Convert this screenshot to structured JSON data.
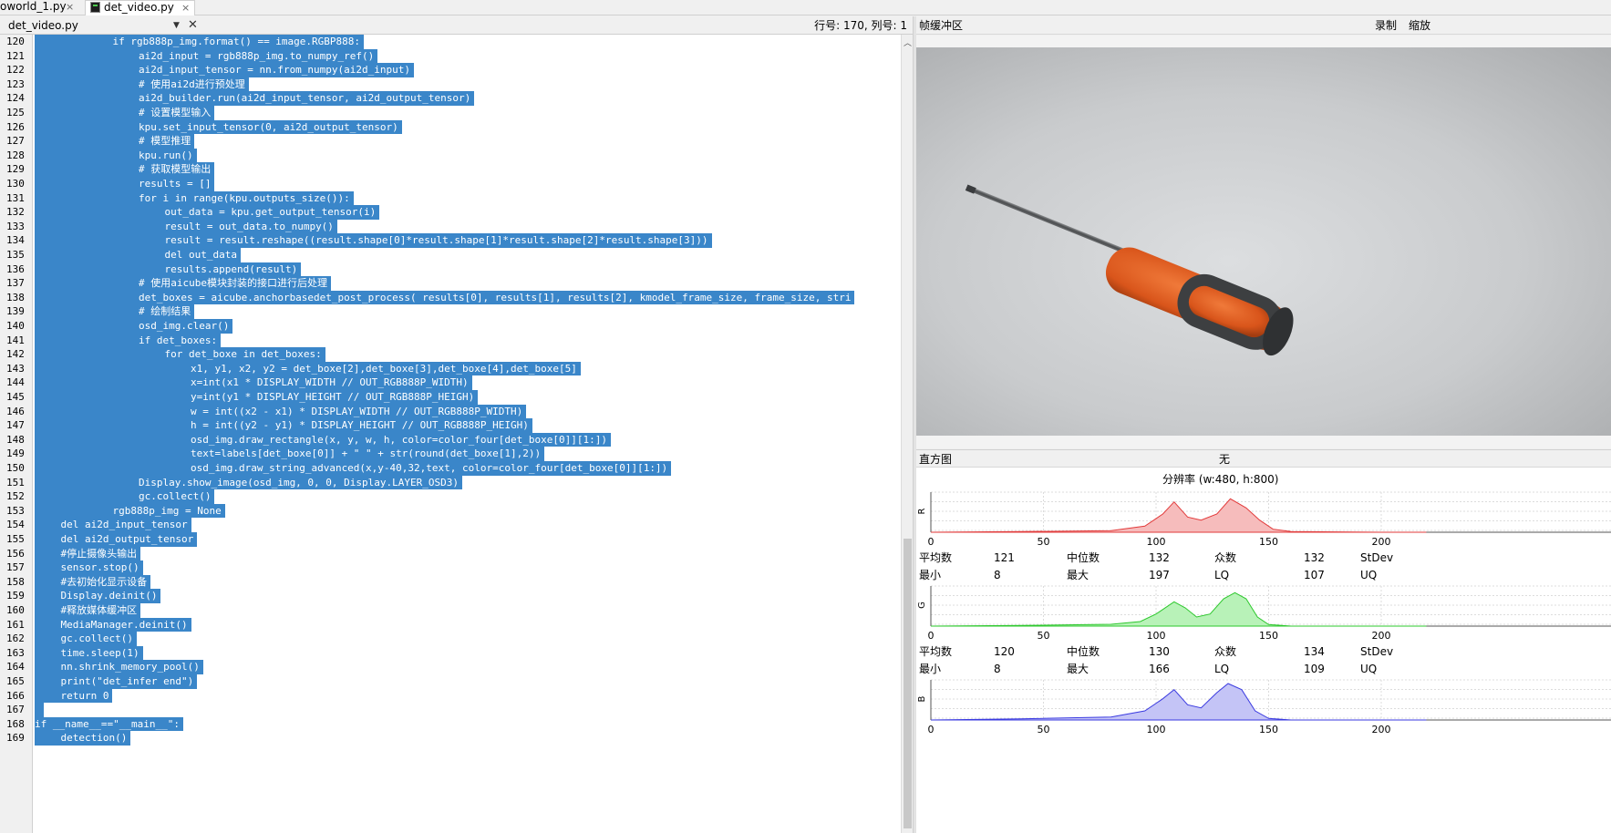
{
  "tabs": [
    {
      "label": "oworld_1.py",
      "close": "×"
    },
    {
      "label": "det_video.py",
      "close": "×"
    }
  ],
  "editor_header": {
    "filename": "det_video.py",
    "dropdown": "▼",
    "close": "✕",
    "position": "行号: 170, 列号: 1"
  },
  "code_lines": [
    {
      "n": "120",
      "indent": 3,
      "text": "if rgb888p_img.format() == image.RGBP888:"
    },
    {
      "n": "121",
      "indent": 4,
      "text": "ai2d_input = rgb888p_img.to_numpy_ref()"
    },
    {
      "n": "122",
      "indent": 4,
      "text": "ai2d_input_tensor = nn.from_numpy(ai2d_input)"
    },
    {
      "n": "123",
      "indent": 4,
      "text": "# 使用ai2d进行预处理"
    },
    {
      "n": "124",
      "indent": 4,
      "text": "ai2d_builder.run(ai2d_input_tensor, ai2d_output_tensor)"
    },
    {
      "n": "125",
      "indent": 4,
      "text": "# 设置模型输入"
    },
    {
      "n": "126",
      "indent": 4,
      "text": "kpu.set_input_tensor(0, ai2d_output_tensor)"
    },
    {
      "n": "127",
      "indent": 4,
      "text": "# 模型推理"
    },
    {
      "n": "128",
      "indent": 4,
      "text": "kpu.run()"
    },
    {
      "n": "129",
      "indent": 4,
      "text": "# 获取模型输出"
    },
    {
      "n": "130",
      "indent": 4,
      "text": "results = []"
    },
    {
      "n": "131",
      "indent": 4,
      "text": "for i in range(kpu.outputs_size()):"
    },
    {
      "n": "132",
      "indent": 5,
      "text": "out_data = kpu.get_output_tensor(i)"
    },
    {
      "n": "133",
      "indent": 5,
      "text": "result = out_data.to_numpy()"
    },
    {
      "n": "134",
      "indent": 5,
      "text": "result = result.reshape((result.shape[0]*result.shape[1]*result.shape[2]*result.shape[3]))"
    },
    {
      "n": "135",
      "indent": 5,
      "text": "del out_data"
    },
    {
      "n": "136",
      "indent": 5,
      "text": "results.append(result)"
    },
    {
      "n": "137",
      "indent": 4,
      "text": "# 使用aicube模块封装的接口进行后处理"
    },
    {
      "n": "138",
      "indent": 4,
      "text": "det_boxes = aicube.anchorbasedet_post_process( results[0], results[1], results[2], kmodel_frame_size, frame_size, stri"
    },
    {
      "n": "139",
      "indent": 4,
      "text": "# 绘制结果"
    },
    {
      "n": "140",
      "indent": 4,
      "text": "osd_img.clear()"
    },
    {
      "n": "141",
      "indent": 4,
      "text": "if det_boxes:"
    },
    {
      "n": "142",
      "indent": 5,
      "text": "for det_boxe in det_boxes:"
    },
    {
      "n": "143",
      "indent": 6,
      "text": "x1, y1, x2, y2 = det_boxe[2],det_boxe[3],det_boxe[4],det_boxe[5]"
    },
    {
      "n": "144",
      "indent": 6,
      "text": "x=int(x1 * DISPLAY_WIDTH // OUT_RGB888P_WIDTH)"
    },
    {
      "n": "145",
      "indent": 6,
      "text": "y=int(y1 * DISPLAY_HEIGHT // OUT_RGB888P_HEIGH)"
    },
    {
      "n": "146",
      "indent": 6,
      "text": "w = int((x2 - x1) * DISPLAY_WIDTH // OUT_RGB888P_WIDTH)"
    },
    {
      "n": "147",
      "indent": 6,
      "text": "h = int((y2 - y1) * DISPLAY_HEIGHT // OUT_RGB888P_HEIGH)"
    },
    {
      "n": "148",
      "indent": 6,
      "text": "osd_img.draw_rectangle(x, y, w, h, color=color_four[det_boxe[0]][1:])"
    },
    {
      "n": "149",
      "indent": 6,
      "text": "text=labels[det_boxe[0]] + \" \" + str(round(det_boxe[1],2))"
    },
    {
      "n": "150",
      "indent": 6,
      "text": "osd_img.draw_string_advanced(x,y-40,32,text, color=color_four[det_boxe[0]][1:])"
    },
    {
      "n": "151",
      "indent": 4,
      "text": "Display.show_image(osd_img, 0, 0, Display.LAYER_OSD3)"
    },
    {
      "n": "152",
      "indent": 4,
      "text": "gc.collect()"
    },
    {
      "n": "153",
      "indent": 3,
      "text": "rgb888p_img = None"
    },
    {
      "n": "154",
      "indent": 1,
      "text": "del ai2d_input_tensor"
    },
    {
      "n": "155",
      "indent": 1,
      "text": "del ai2d_output_tensor"
    },
    {
      "n": "156",
      "indent": 1,
      "text": "#停止摄像头输出"
    },
    {
      "n": "157",
      "indent": 1,
      "text": "sensor.stop()"
    },
    {
      "n": "158",
      "indent": 1,
      "text": "#去初始化显示设备"
    },
    {
      "n": "159",
      "indent": 1,
      "text": "Display.deinit()"
    },
    {
      "n": "160",
      "indent": 1,
      "text": "#释放媒体缓冲区"
    },
    {
      "n": "161",
      "indent": 1,
      "text": "MediaManager.deinit()"
    },
    {
      "n": "162",
      "indent": 1,
      "text": "gc.collect()"
    },
    {
      "n": "163",
      "indent": 1,
      "text": "time.sleep(1)"
    },
    {
      "n": "164",
      "indent": 1,
      "text": "nn.shrink_memory_pool()"
    },
    {
      "n": "165",
      "indent": 1,
      "text": "print(\"det_infer end\")"
    },
    {
      "n": "166",
      "indent": 1,
      "text": "return 0"
    },
    {
      "n": "167",
      "indent": 0,
      "text": ""
    },
    {
      "n": "168",
      "indent": 0,
      "text": "if __name__==\"__main__\":"
    },
    {
      "n": "169",
      "indent": 1,
      "text": "detection()"
    }
  ],
  "framebuffer": {
    "title": "帧缓冲区",
    "record": "录制",
    "zoom": "缩放"
  },
  "histogram": {
    "title": "直方图",
    "mode": "无",
    "resolution": "分辨率 (w:480, h:800)",
    "ticks": [
      "0",
      "50",
      "100",
      "150",
      "200"
    ],
    "channels": [
      {
        "id": "R",
        "color": "#e23a3a",
        "fill": "#f6bcbc",
        "stats1": [
          "平均数",
          "121",
          "中位数",
          "132",
          "众数",
          "132",
          "StDev"
        ],
        "stats2": [
          "最小",
          "8",
          "最大",
          "197",
          "LQ",
          "107",
          "UQ"
        ]
      },
      {
        "id": "G",
        "color": "#2dc82d",
        "fill": "#b8f2b8",
        "stats1": [
          "平均数",
          "120",
          "中位数",
          "130",
          "众数",
          "134",
          "StDev"
        ],
        "stats2": [
          "最小",
          "8",
          "最大",
          "166",
          "LQ",
          "109",
          "UQ"
        ]
      },
      {
        "id": "B",
        "color": "#3a3ae0",
        "fill": "#c4c4f6"
      }
    ]
  },
  "chart_data": [
    {
      "type": "area",
      "series": [
        {
          "name": "R",
          "values": [
            [
              0,
              0
            ],
            [
              40,
              0.2
            ],
            [
              80,
              0.5
            ],
            [
              95,
              2
            ],
            [
              103,
              6
            ],
            [
              108,
              10
            ],
            [
              114,
              5
            ],
            [
              120,
              4
            ],
            [
              127,
              6
            ],
            [
              133,
              11
            ],
            [
              140,
              8
            ],
            [
              146,
              4
            ],
            [
              152,
              1
            ],
            [
              160,
              0.2
            ],
            [
              200,
              0
            ]
          ]
        }
      ],
      "xlim": [
        0,
        220
      ]
    },
    {
      "type": "area",
      "series": [
        {
          "name": "G",
          "values": [
            [
              0,
              0
            ],
            [
              40,
              0.2
            ],
            [
              80,
              0.6
            ],
            [
              93,
              1.5
            ],
            [
              100,
              4
            ],
            [
              108,
              8
            ],
            [
              113,
              6
            ],
            [
              118,
              3
            ],
            [
              124,
              4
            ],
            [
              130,
              9
            ],
            [
              135,
              11
            ],
            [
              140,
              9
            ],
            [
              145,
              3
            ],
            [
              150,
              0.5
            ],
            [
              160,
              0
            ],
            [
              200,
              0
            ]
          ]
        }
      ],
      "xlim": [
        0,
        220
      ]
    },
    {
      "type": "area",
      "series": [
        {
          "name": "B",
          "values": [
            [
              0,
              0
            ],
            [
              40,
              0.4
            ],
            [
              80,
              1
            ],
            [
              95,
              3
            ],
            [
              103,
              7
            ],
            [
              108,
              10
            ],
            [
              114,
              5
            ],
            [
              120,
              4
            ],
            [
              127,
              9
            ],
            [
              132,
              12
            ],
            [
              138,
              10
            ],
            [
              144,
              3
            ],
            [
              150,
              0.5
            ],
            [
              160,
              0
            ],
            [
              200,
              0
            ]
          ]
        }
      ],
      "xlim": [
        0,
        220
      ]
    }
  ]
}
